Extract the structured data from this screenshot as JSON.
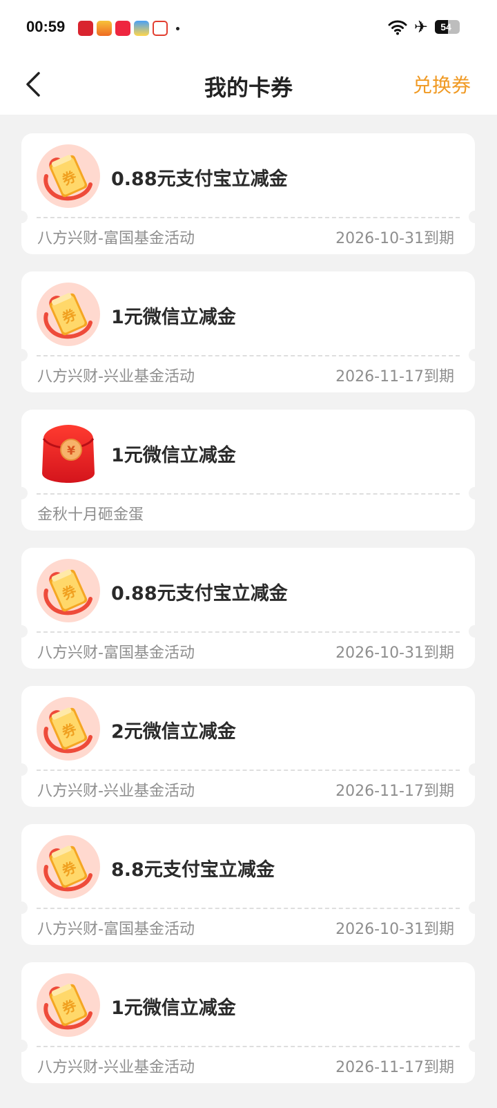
{
  "status_bar": {
    "time": "00:59",
    "battery": "54",
    "battery_level": 0.54,
    "icons": [
      "wifi-icon",
      "airplane-mode-icon",
      "battery-icon"
    ]
  },
  "nav": {
    "title": "我的卡券",
    "action": "兑换券",
    "back_icon": "chevron-left-icon"
  },
  "colors": {
    "accent": "#f09a24",
    "background": "#f2f2f2",
    "card": "#ffffff",
    "title_text": "#2a2a2a",
    "secondary_text": "#8e8e8e"
  },
  "coupons": [
    {
      "icon": "gold-coupon-icon",
      "title": "0.88元支付宝立减金",
      "source": "八方兴财-富国基金活动",
      "expiry": "2026-10-31到期"
    },
    {
      "icon": "gold-coupon-icon",
      "title": "1元微信立减金",
      "source": "八方兴财-兴业基金活动",
      "expiry": "2026-11-17到期"
    },
    {
      "icon": "red-envelope-icon",
      "title": "1元微信立减金",
      "source": "金秋十月砸金蛋",
      "expiry": ""
    },
    {
      "icon": "gold-coupon-icon",
      "title": "0.88元支付宝立减金",
      "source": "八方兴财-富国基金活动",
      "expiry": "2026-10-31到期"
    },
    {
      "icon": "gold-coupon-icon",
      "title": "2元微信立减金",
      "source": "八方兴财-兴业基金活动",
      "expiry": "2026-11-17到期"
    },
    {
      "icon": "gold-coupon-icon",
      "title": "8.8元支付宝立减金",
      "source": "八方兴财-富国基金活动",
      "expiry": "2026-10-31到期"
    },
    {
      "icon": "gold-coupon-icon",
      "title": "1元微信立减金",
      "source": "八方兴财-兴业基金活动",
      "expiry": "2026-11-17到期"
    }
  ]
}
